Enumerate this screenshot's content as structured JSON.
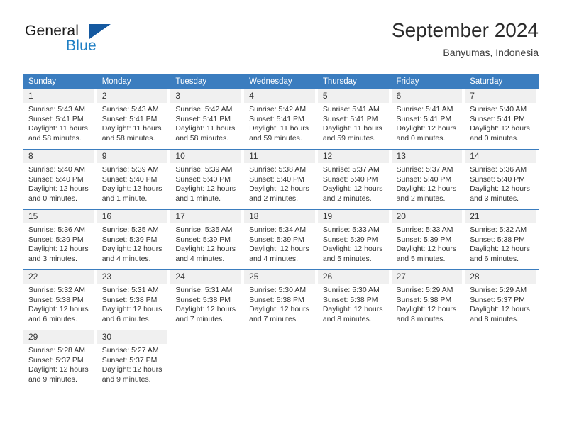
{
  "brand": {
    "name_part1": "General",
    "name_part2": "Blue",
    "flag_icon": "blue-triangle-flag-icon"
  },
  "header": {
    "month_title": "September 2024",
    "location": "Banyumas, Indonesia"
  },
  "colors": {
    "header_blue": "#3b7dbf",
    "brand_blue": "#1f7fc4",
    "brand_flag_blue": "#1559a0",
    "daynum_background": "#f0f0f0",
    "text": "#333333"
  },
  "weekday_headers": [
    "Sunday",
    "Monday",
    "Tuesday",
    "Wednesday",
    "Thursday",
    "Friday",
    "Saturday"
  ],
  "weeks": [
    [
      {
        "day": "1",
        "sunrise": "Sunrise: 5:43 AM",
        "sunset": "Sunset: 5:41 PM",
        "daylight_line1": "Daylight: 11 hours",
        "daylight_line2": "and 58 minutes."
      },
      {
        "day": "2",
        "sunrise": "Sunrise: 5:43 AM",
        "sunset": "Sunset: 5:41 PM",
        "daylight_line1": "Daylight: 11 hours",
        "daylight_line2": "and 58 minutes."
      },
      {
        "day": "3",
        "sunrise": "Sunrise: 5:42 AM",
        "sunset": "Sunset: 5:41 PM",
        "daylight_line1": "Daylight: 11 hours",
        "daylight_line2": "and 58 minutes."
      },
      {
        "day": "4",
        "sunrise": "Sunrise: 5:42 AM",
        "sunset": "Sunset: 5:41 PM",
        "daylight_line1": "Daylight: 11 hours",
        "daylight_line2": "and 59 minutes."
      },
      {
        "day": "5",
        "sunrise": "Sunrise: 5:41 AM",
        "sunset": "Sunset: 5:41 PM",
        "daylight_line1": "Daylight: 11 hours",
        "daylight_line2": "and 59 minutes."
      },
      {
        "day": "6",
        "sunrise": "Sunrise: 5:41 AM",
        "sunset": "Sunset: 5:41 PM",
        "daylight_line1": "Daylight: 12 hours",
        "daylight_line2": "and 0 minutes."
      },
      {
        "day": "7",
        "sunrise": "Sunrise: 5:40 AM",
        "sunset": "Sunset: 5:41 PM",
        "daylight_line1": "Daylight: 12 hours",
        "daylight_line2": "and 0 minutes."
      }
    ],
    [
      {
        "day": "8",
        "sunrise": "Sunrise: 5:40 AM",
        "sunset": "Sunset: 5:40 PM",
        "daylight_line1": "Daylight: 12 hours",
        "daylight_line2": "and 0 minutes."
      },
      {
        "day": "9",
        "sunrise": "Sunrise: 5:39 AM",
        "sunset": "Sunset: 5:40 PM",
        "daylight_line1": "Daylight: 12 hours",
        "daylight_line2": "and 1 minute."
      },
      {
        "day": "10",
        "sunrise": "Sunrise: 5:39 AM",
        "sunset": "Sunset: 5:40 PM",
        "daylight_line1": "Daylight: 12 hours",
        "daylight_line2": "and 1 minute."
      },
      {
        "day": "11",
        "sunrise": "Sunrise: 5:38 AM",
        "sunset": "Sunset: 5:40 PM",
        "daylight_line1": "Daylight: 12 hours",
        "daylight_line2": "and 2 minutes."
      },
      {
        "day": "12",
        "sunrise": "Sunrise: 5:37 AM",
        "sunset": "Sunset: 5:40 PM",
        "daylight_line1": "Daylight: 12 hours",
        "daylight_line2": "and 2 minutes."
      },
      {
        "day": "13",
        "sunrise": "Sunrise: 5:37 AM",
        "sunset": "Sunset: 5:40 PM",
        "daylight_line1": "Daylight: 12 hours",
        "daylight_line2": "and 2 minutes."
      },
      {
        "day": "14",
        "sunrise": "Sunrise: 5:36 AM",
        "sunset": "Sunset: 5:40 PM",
        "daylight_line1": "Daylight: 12 hours",
        "daylight_line2": "and 3 minutes."
      }
    ],
    [
      {
        "day": "15",
        "sunrise": "Sunrise: 5:36 AM",
        "sunset": "Sunset: 5:39 PM",
        "daylight_line1": "Daylight: 12 hours",
        "daylight_line2": "and 3 minutes."
      },
      {
        "day": "16",
        "sunrise": "Sunrise: 5:35 AM",
        "sunset": "Sunset: 5:39 PM",
        "daylight_line1": "Daylight: 12 hours",
        "daylight_line2": "and 4 minutes."
      },
      {
        "day": "17",
        "sunrise": "Sunrise: 5:35 AM",
        "sunset": "Sunset: 5:39 PM",
        "daylight_line1": "Daylight: 12 hours",
        "daylight_line2": "and 4 minutes."
      },
      {
        "day": "18",
        "sunrise": "Sunrise: 5:34 AM",
        "sunset": "Sunset: 5:39 PM",
        "daylight_line1": "Daylight: 12 hours",
        "daylight_line2": "and 4 minutes."
      },
      {
        "day": "19",
        "sunrise": "Sunrise: 5:33 AM",
        "sunset": "Sunset: 5:39 PM",
        "daylight_line1": "Daylight: 12 hours",
        "daylight_line2": "and 5 minutes."
      },
      {
        "day": "20",
        "sunrise": "Sunrise: 5:33 AM",
        "sunset": "Sunset: 5:39 PM",
        "daylight_line1": "Daylight: 12 hours",
        "daylight_line2": "and 5 minutes."
      },
      {
        "day": "21",
        "sunrise": "Sunrise: 5:32 AM",
        "sunset": "Sunset: 5:38 PM",
        "daylight_line1": "Daylight: 12 hours",
        "daylight_line2": "and 6 minutes."
      }
    ],
    [
      {
        "day": "22",
        "sunrise": "Sunrise: 5:32 AM",
        "sunset": "Sunset: 5:38 PM",
        "daylight_line1": "Daylight: 12 hours",
        "daylight_line2": "and 6 minutes."
      },
      {
        "day": "23",
        "sunrise": "Sunrise: 5:31 AM",
        "sunset": "Sunset: 5:38 PM",
        "daylight_line1": "Daylight: 12 hours",
        "daylight_line2": "and 6 minutes."
      },
      {
        "day": "24",
        "sunrise": "Sunrise: 5:31 AM",
        "sunset": "Sunset: 5:38 PM",
        "daylight_line1": "Daylight: 12 hours",
        "daylight_line2": "and 7 minutes."
      },
      {
        "day": "25",
        "sunrise": "Sunrise: 5:30 AM",
        "sunset": "Sunset: 5:38 PM",
        "daylight_line1": "Daylight: 12 hours",
        "daylight_line2": "and 7 minutes."
      },
      {
        "day": "26",
        "sunrise": "Sunrise: 5:30 AM",
        "sunset": "Sunset: 5:38 PM",
        "daylight_line1": "Daylight: 12 hours",
        "daylight_line2": "and 8 minutes."
      },
      {
        "day": "27",
        "sunrise": "Sunrise: 5:29 AM",
        "sunset": "Sunset: 5:38 PM",
        "daylight_line1": "Daylight: 12 hours",
        "daylight_line2": "and 8 minutes."
      },
      {
        "day": "28",
        "sunrise": "Sunrise: 5:29 AM",
        "sunset": "Sunset: 5:37 PM",
        "daylight_line1": "Daylight: 12 hours",
        "daylight_line2": "and 8 minutes."
      }
    ],
    [
      {
        "day": "29",
        "sunrise": "Sunrise: 5:28 AM",
        "sunset": "Sunset: 5:37 PM",
        "daylight_line1": "Daylight: 12 hours",
        "daylight_line2": "and 9 minutes."
      },
      {
        "day": "30",
        "sunrise": "Sunrise: 5:27 AM",
        "sunset": "Sunset: 5:37 PM",
        "daylight_line1": "Daylight: 12 hours",
        "daylight_line2": "and 9 minutes."
      },
      {
        "day": "",
        "sunrise": "",
        "sunset": "",
        "daylight_line1": "",
        "daylight_line2": ""
      },
      {
        "day": "",
        "sunrise": "",
        "sunset": "",
        "daylight_line1": "",
        "daylight_line2": ""
      },
      {
        "day": "",
        "sunrise": "",
        "sunset": "",
        "daylight_line1": "",
        "daylight_line2": ""
      },
      {
        "day": "",
        "sunrise": "",
        "sunset": "",
        "daylight_line1": "",
        "daylight_line2": ""
      },
      {
        "day": "",
        "sunrise": "",
        "sunset": "",
        "daylight_line1": "",
        "daylight_line2": ""
      }
    ]
  ]
}
